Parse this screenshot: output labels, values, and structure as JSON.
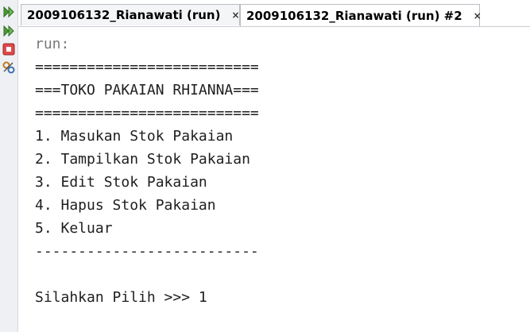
{
  "tabs": [
    {
      "label": "2009106132_Rianawati (run)",
      "close": "×"
    },
    {
      "label": "2009106132_Rianawati (run) #2",
      "close": "×"
    }
  ],
  "toolbar": {
    "icons": [
      "rerun-icon",
      "rerun-with-options-icon",
      "stop-icon",
      "settings-icon"
    ],
    "colors": {
      "run": "#3f8d2f",
      "stop": "#d13d3d"
    }
  },
  "console": {
    "lines": [
      "run:",
      "==========================",
      "===TOKO PAKAIAN RHIANNA===",
      "==========================",
      "1. Masukan Stok Pakaian",
      "2. Tampilkan Stok Pakaian",
      "3. Edit Stok Pakaian",
      "4. Hapus Stok Pakaian",
      "5. Keluar",
      "--------------------------",
      "Silahkan Pilih >>> 1"
    ]
  }
}
